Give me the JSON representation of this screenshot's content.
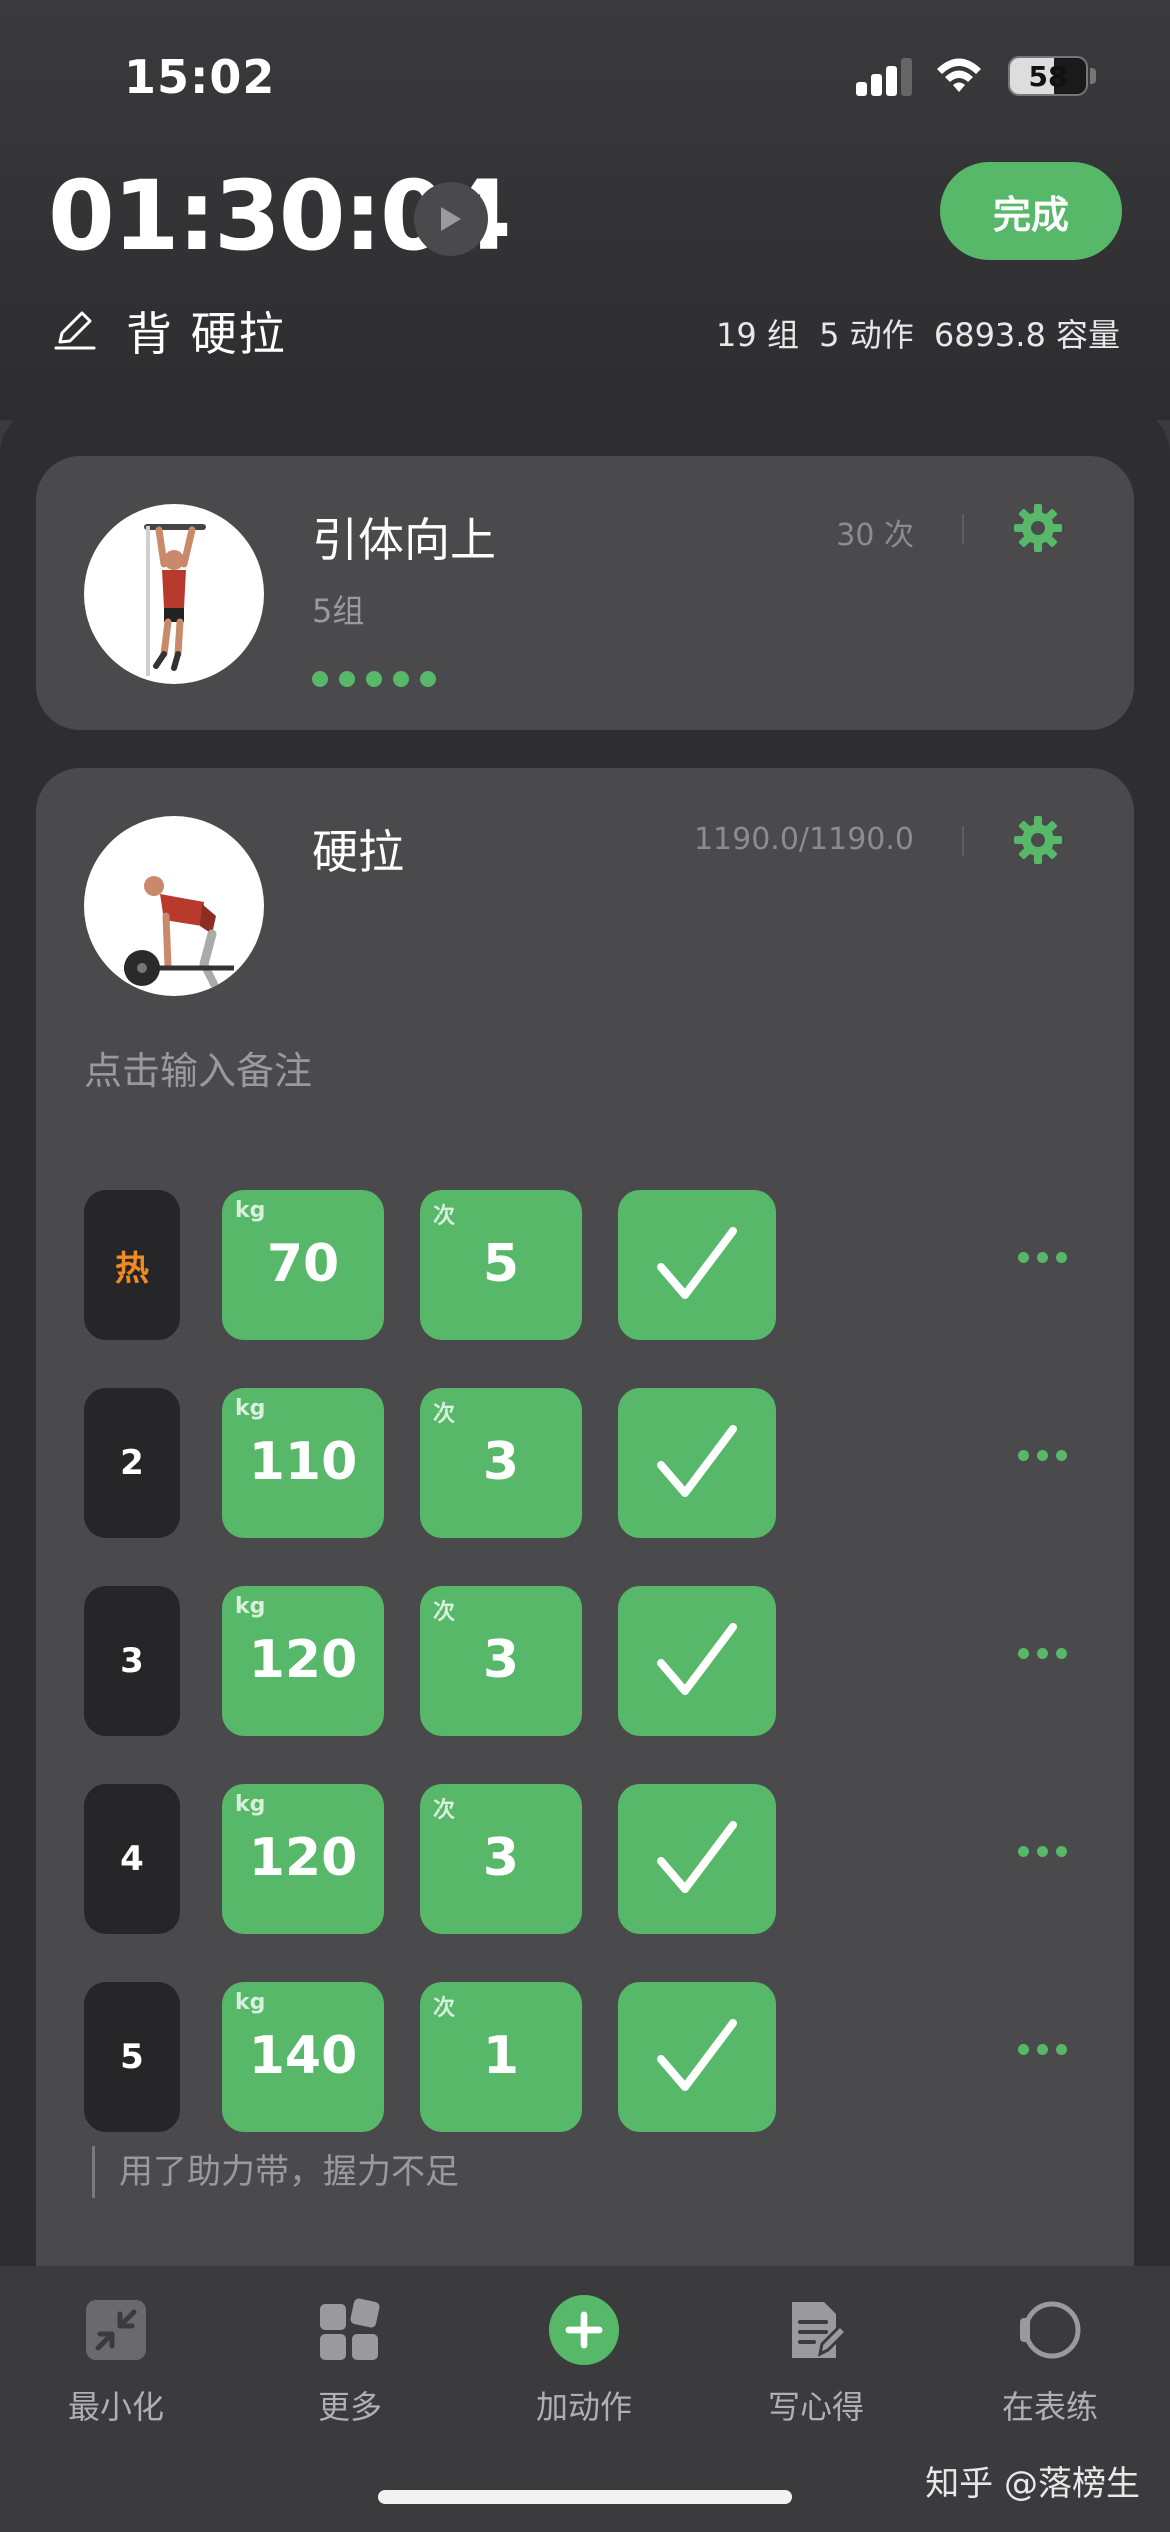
{
  "status_bar": {
    "time": "15:02",
    "battery": "58",
    "battery_level": 0.58
  },
  "header": {
    "timer": "01:30:04",
    "finish_label": "完成",
    "workout_name": "背 硬拉",
    "stats": {
      "sets": "19 组",
      "exercises": "5 动作",
      "volume": "6893.8 容量"
    }
  },
  "exercises": [
    {
      "name": "引体向上",
      "sub": "5组",
      "meta": "30 次",
      "progress_dots": 5
    },
    {
      "name": "硬拉",
      "meta": "1190.0/1190.0",
      "note_placeholder": "点击输入备注",
      "sets": [
        {
          "index": "热",
          "kg": "70",
          "reps": "5"
        },
        {
          "index": "2",
          "kg": "110",
          "reps": "3"
        },
        {
          "index": "3",
          "kg": "120",
          "reps": "3"
        },
        {
          "index": "4",
          "kg": "120",
          "reps": "3"
        },
        {
          "index": "5",
          "kg": "140",
          "reps": "1"
        }
      ],
      "unit_kg": "kg",
      "unit_reps": "次",
      "set_note": "用了助力带，握力不足"
    }
  ],
  "bottom_tabs": [
    {
      "label": "最小化",
      "icon": "minimize-icon"
    },
    {
      "label": "更多",
      "icon": "grid-icon"
    },
    {
      "label": "加动作",
      "icon": "add-circle-icon"
    },
    {
      "label": "写心得",
      "icon": "note-edit-icon"
    },
    {
      "label": "在表练",
      "icon": "watch-icon"
    }
  ],
  "watermark": "知乎 @落榜生",
  "colors": {
    "accent": "#56b868",
    "warmup": "#f08a24",
    "background": "#3b3b3e",
    "card": "#4a4a4d"
  }
}
